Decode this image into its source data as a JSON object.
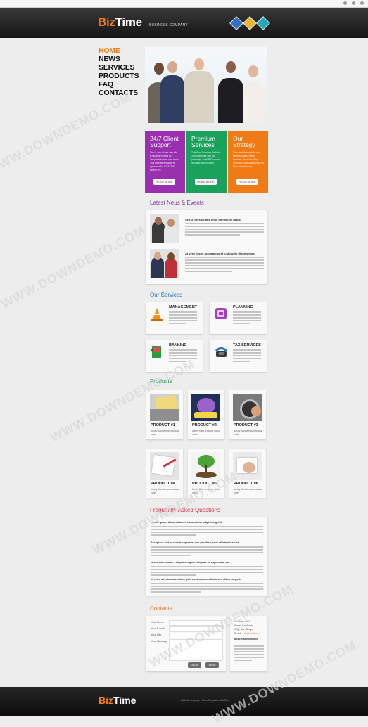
{
  "header": {
    "logo_biz": "Biz",
    "logo_time": "Time",
    "tagline": "BUSINESS COMPANY"
  },
  "nav": [
    "HOME",
    "NEWS",
    "SERVICES",
    "PRODUCTS",
    "FAQ",
    "CONTACTS"
  ],
  "feature_boxes": [
    {
      "title_1": "24/7 Client",
      "title_2": "Support",
      "text": "This is one of free web site templates created by TemplateMonster.com team. This website template is optimized for 1024X768 screen res.",
      "button": "READ MORE",
      "color": "#9a2fb0"
    },
    {
      "title_1": "Premium",
      "title_2": "Services",
      "text": "This Free Business Website Template goes with two packages - with PSD source files and without them.",
      "button": "READ MORE",
      "color": "#1aa15c"
    },
    {
      "title_1": "Our",
      "title_2": "Strategy",
      "text": "This website template has several pages: News, Services, Products, Faq, Contacts (note that contact us form doesn't work).",
      "button": "READ MORE",
      "color": "#f07a14"
    }
  ],
  "news": {
    "title": "Latest Neus & Events",
    "items": [
      {
        "heading": "Sed ut perspiciatis unde omnis iste natus"
      },
      {
        "heading": "At vero eos et accusamus et iusto odio dignissimos"
      }
    ]
  },
  "services": {
    "title": "Our Services",
    "items": [
      {
        "name": "MANAGEMENT",
        "icon": "cone-icon"
      },
      {
        "name": "PLANNING",
        "icon": "planner-icon"
      },
      {
        "name": "BANKING",
        "icon": "binder-icon"
      },
      {
        "name": "TAX SERVICES",
        "icon": "phone-icon"
      }
    ]
  },
  "products": {
    "title": "Products",
    "items": [
      "PRODUCT #1",
      "PRODUCT #2",
      "PRODUCT #3",
      "PRODUCT #4",
      "PRODUCT #5",
      "PRODUCT #6"
    ],
    "desc": "Nashy Baro temporo soluta nobis"
  },
  "faq": {
    "title": "Frequently Asked Questions",
    "items": [
      "Lorem ipsum dolor sit amet, consectetur adipisicing elit",
      "Excepteur sint occaecat cupidatat non proident, sunt officia deserunt",
      "Nemo enim ipsam voluptatem quia voluptas sit aspernatur aut",
      "Ut enim ad minima veniam, quis nostrum exercitationem ullam corporis"
    ]
  },
  "contacts": {
    "title": "Contacts",
    "labels": [
      "Your Name",
      "Your E-mail",
      "Your City",
      "Your Message"
    ],
    "clear": "CLEAR",
    "send": "SEND",
    "info": [
      {
        "k": "Country:",
        "v": "USA"
      },
      {
        "k": "State:",
        "v": "California"
      },
      {
        "k": "City:",
        "v": "San Diego"
      },
      {
        "k": "Email:",
        "v": "info@mail.com"
      }
    ],
    "misc_title": "Miscellaneous info"
  },
  "footer": {
    "logo_biz": "Biz",
    "logo_time": "Time",
    "copy": "Website template | More Templates: BizTime"
  },
  "watermark": "WWW.DOWNDEMO.COM"
}
